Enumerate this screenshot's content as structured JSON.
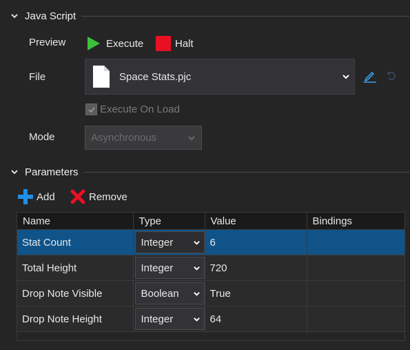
{
  "java_script": {
    "title": "Java Script",
    "preview_label": "Preview",
    "execute_label": "Execute",
    "halt_label": "Halt",
    "file_label": "File",
    "file_value": "Space Stats.pjc",
    "execute_on_load_label": "Execute On Load",
    "execute_on_load_checked": true,
    "mode_label": "Mode",
    "mode_value": "Asynchronous"
  },
  "parameters": {
    "title": "Parameters",
    "add_label": "Add",
    "remove_label": "Remove",
    "columns": [
      "Name",
      "Type",
      "Value",
      "Bindings"
    ],
    "rows": [
      {
        "name": "Stat Count",
        "type": "Integer",
        "value": "6",
        "bindings": "",
        "selected": true
      },
      {
        "name": "Total Height",
        "type": "Integer",
        "value": "720",
        "bindings": "",
        "selected": false
      },
      {
        "name": "Drop Note Visible",
        "type": "Boolean",
        "value": "True",
        "bindings": "",
        "selected": false
      },
      {
        "name": "Drop Note Height",
        "type": "Integer",
        "value": "64",
        "bindings": "",
        "selected": false
      }
    ]
  },
  "colors": {
    "background": "#252526",
    "selection": "#0f5389",
    "execute_green": "#3cc13c",
    "halt_red": "#e81123",
    "add_blue": "#1e8fe8",
    "remove_red": "#e81123",
    "link_blue": "#3c9ee8"
  },
  "icons": [
    "chevron-down-icon",
    "play-icon",
    "stop-icon",
    "document-icon",
    "pencil-icon",
    "undo-icon",
    "check-icon",
    "plus-icon",
    "x-icon"
  ]
}
